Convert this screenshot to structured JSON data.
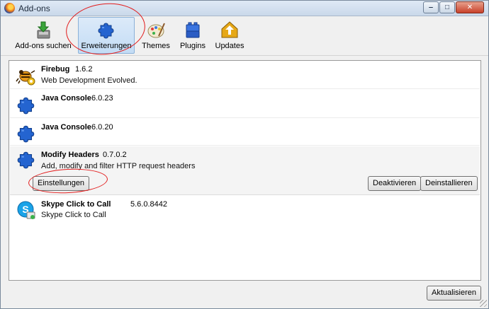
{
  "window": {
    "title": "Add-ons"
  },
  "caption": {
    "minimize": "‒",
    "maximize": "□",
    "close": "✕"
  },
  "toolbar": {
    "items": [
      {
        "label": "Add-ons suchen",
        "icon": "download-addon-icon",
        "selected": false
      },
      {
        "label": "Erweiterungen",
        "icon": "puzzle-piece-icon",
        "selected": true
      },
      {
        "label": "Themes",
        "icon": "palette-icon",
        "selected": false
      },
      {
        "label": "Plugins",
        "icon": "blocks-icon",
        "selected": false
      },
      {
        "label": "Updates",
        "icon": "update-arrow-icon",
        "selected": false
      }
    ]
  },
  "addons": [
    {
      "name": "Firebug",
      "version": "1.6.2",
      "description": "Web Development Evolved.",
      "icon": "firebug-icon"
    },
    {
      "name": "Java Console",
      "version": "6.0.23",
      "description": "",
      "icon": "puzzle-piece-icon"
    },
    {
      "name": "Java Console",
      "version": "6.0.20",
      "description": "",
      "icon": "puzzle-piece-icon"
    },
    {
      "name": "Modify Headers",
      "version": "0.7.0.2",
      "description": "Add, modify and filter HTTP request headers",
      "icon": "puzzle-piece-icon",
      "selected": true,
      "buttons": {
        "settings": "Einstellungen",
        "disable": "Deaktivieren",
        "uninstall": "Deinstallieren"
      }
    },
    {
      "name": "Skype Click to Call",
      "version": "5.6.0.8442",
      "description": "Skype Click to Call",
      "icon": "skype-icon"
    }
  ],
  "footer": {
    "update_button": "Aktualisieren"
  },
  "colors": {
    "annotation": "#e21c1c",
    "selection": "#c3dcf5",
    "puzzle": "#2464d0"
  }
}
